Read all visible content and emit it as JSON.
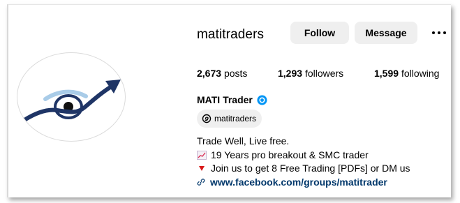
{
  "profile": {
    "username": "matitraders",
    "display_name": "MATI Trader",
    "verified": true,
    "threads_handle": "matitraders"
  },
  "actions": {
    "follow_label": "Follow",
    "message_label": "Message",
    "more_icon": "more-horizontal-icon"
  },
  "stats": {
    "posts_count": "2,673",
    "posts_label": "posts",
    "followers_count": "1,293",
    "followers_label": "followers",
    "following_count": "1,599",
    "following_label": "following"
  },
  "bio": {
    "line1": "Trade Well, Live free.",
    "line2": "19 Years pro breakout & SMC trader",
    "line3": "Join us to get 8 Free Trading [PDFs] or DM us",
    "link": "www.facebook.com/groups/matitrader"
  },
  "colors": {
    "button_bg": "#efefef",
    "link_color": "#00376b",
    "verified_blue": "#0095f6",
    "logo_navy": "#1f3566",
    "logo_light_blue": "#a9cce8"
  }
}
